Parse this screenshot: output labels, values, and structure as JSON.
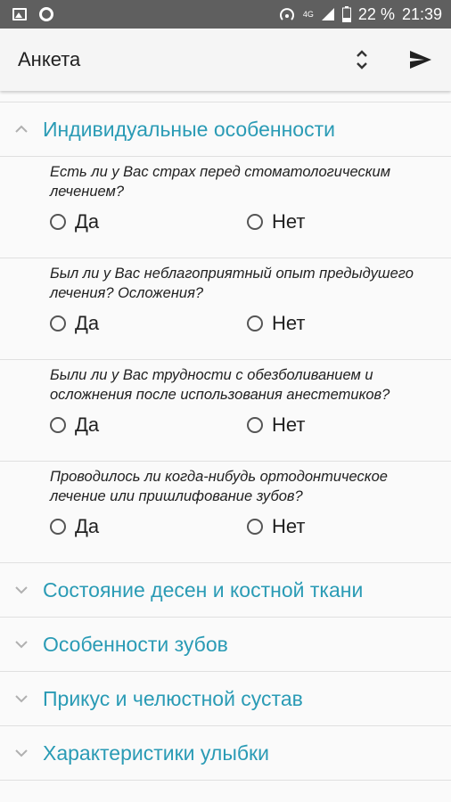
{
  "statusbar": {
    "network": "4G",
    "battery": "22 %",
    "time": "21:39"
  },
  "appbar": {
    "title": "Анкета"
  },
  "groups": [
    {
      "title": "Индивидуальные особенности",
      "questions": [
        {
          "text": "Есть ли у Вас страх перед стоматологическим лечением?",
          "options": [
            "Да",
            "Нет"
          ]
        },
        {
          "text": "Был ли у Вас неблагоприятный опыт предыдушего лечения? Осложения?",
          "options": [
            "Да",
            "Нет"
          ]
        },
        {
          "text": "Были ли у Вас трудности с обезболиванием и осложнения после использования анестетиков?",
          "options": [
            "Да",
            "Нет"
          ]
        },
        {
          "text": "Проводилось ли когда-нибудь ортодонтическое лечение или пришлифование зубов?",
          "options": [
            "Да",
            "Нет"
          ]
        }
      ]
    },
    {
      "title": "Состояние десен и костной ткани"
    },
    {
      "title": "Особенности зубов"
    },
    {
      "title": "Прикус и челюстной сустав"
    },
    {
      "title": "Характеристики улыбки"
    }
  ]
}
